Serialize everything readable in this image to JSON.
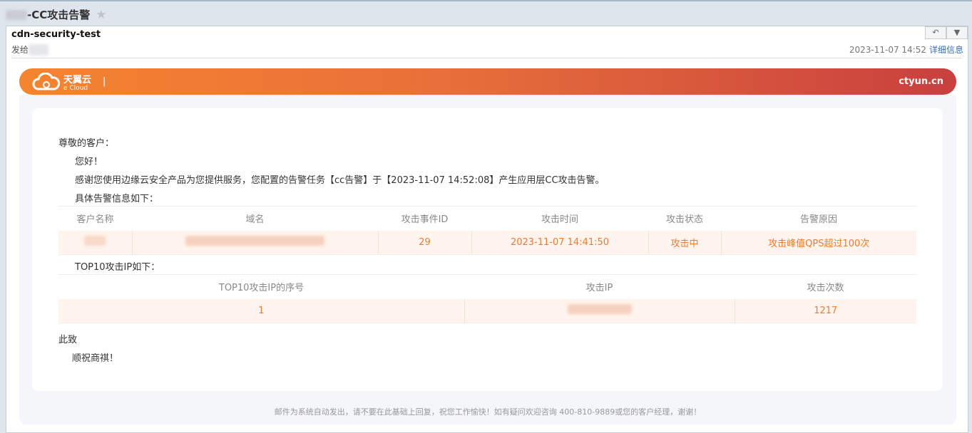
{
  "subject": {
    "title": "-CC攻击告警"
  },
  "header": {
    "from": "cdn-security-test",
    "to_label": "发给",
    "date": "2023-11-07 14:52",
    "details_link": "详细信息",
    "reply_icon": "reply-icon",
    "more_icon": "chevron-down-icon"
  },
  "banner": {
    "logo_cn": "天翼云",
    "logo_en": "e Cloud",
    "separator": "|",
    "site": "ctyun.cn"
  },
  "body": {
    "greeting": "尊敬的客户：",
    "hello": "您好！",
    "intro": "感谢您使用边缘云安全产品为您提供服务，您配置的告警任务【cc告警】于【2023-11-07 14:52:08】产生应用层CC攻击告警。",
    "detail_heading": "具体告警信息如下：",
    "alert_table": {
      "headers": [
        "客户名称",
        "域名",
        "攻击事件ID",
        "攻击时间",
        "攻击状态",
        "告警原因"
      ],
      "row": {
        "event_id": "29",
        "time": "2023-11-07 14:41:50",
        "status": "攻击中",
        "reason": "攻击峰值QPS超过100次"
      }
    },
    "top_heading": "TOP10攻击IP如下：",
    "ip_table": {
      "headers": [
        "TOP10攻击IP的序号",
        "攻击IP",
        "攻击次数"
      ],
      "row": {
        "index": "1",
        "count": "1217"
      }
    },
    "closing": "此致",
    "regards": "顺祝商祺！"
  },
  "footer": "邮件为系统自动发出，请不要在此基础上回复，祝您工作愉快！如有疑问欢迎咨询 400-810-9889或您的客户经理，谢谢！"
}
